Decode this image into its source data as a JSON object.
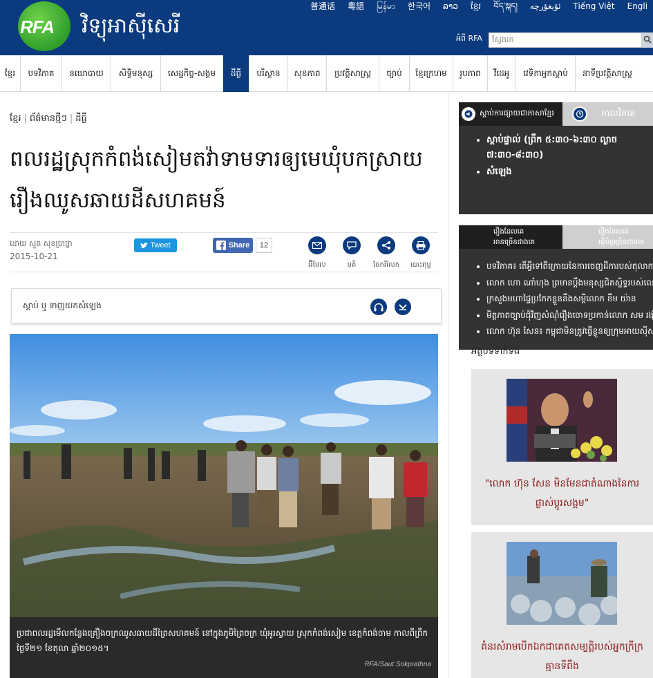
{
  "header": {
    "logo_text": "RFA",
    "site_name": "វិទ្យុអាស៊ីសេរី",
    "languages": [
      "普通话",
      "粵語",
      "မြန်မာ",
      "한국어",
      "ລາວ",
      "ខ្មែរ",
      "བོད་སྐད།",
      "ئۇيغۇرچە",
      "Tiếng Việt",
      "Engli"
    ],
    "about_rfa": "អំពី RFA",
    "search_placeholder": "ស្វែងរក"
  },
  "nav": {
    "items": [
      "ខ្មែរ",
      "បទវិភាគ",
      "នយោបាយ",
      "សិទ្ធិមនុស្ស",
      "សេដ្ឋកិច្ច-សង្គម",
      "ដីធ្លី",
      "បរិស្ថាន",
      "សុខភាព",
      "ប្រវត្តិសាស្ត្រ",
      "ច្បាប់",
      "ខ្មែរក្រហម",
      "រូបភាព",
      "វីដេអូ",
      "វេទិកាអ្នកស្ដាប់",
      "នាទីប្រវត្តិសាស្ត្រ"
    ],
    "active_index": 5
  },
  "breadcrumb": [
    "ខ្មែរ",
    "ព័ត៌មានថ្មីៗ",
    "ដីធ្លី"
  ],
  "article": {
    "title": "ពលរដ្ឋស្រុកកំពង់សៀមតវ៉ាទាមទារឲ្យមេឃុំបកស្រាយរឿងឈូសឆាយដីសហគមន៍",
    "author": "ដោយ សួត សុខប្រាថ្នា",
    "date": "2015-10-21",
    "tweet_label": "Tweet",
    "share_label": "Share",
    "share_count": "12",
    "tools": [
      "អ៊ីមែល",
      "មតិ",
      "ចែករំលែក",
      "បោះពុម្ព"
    ],
    "audio_label": "ស្ដាប់ ឬ ទាញយកសំឡេង",
    "photo_caption": "ប្រជាពលរដ្ឋមើលកន្លែងគ្រឿងចក្រឈូសឆាយដីព្រៃសហគមន៍ នៅក្នុងភូមិព្រៃចក្រ ឃុំអូរស្វាយ ស្រុកកំពង់សៀម ខេត្តកំពង់ចាម កាលពីព្រឹកថ្ងៃទី២១ ខែតុលា ឆ្នាំ២០១៥។",
    "photo_credit": "RFA/Saut Sokprathna"
  },
  "sidebar": {
    "listen_tab": "ស្ដាប់ការផ្សាយជាភាសាខ្មែរ",
    "schedule_tab": "កាលវិភាគ",
    "listen_items": [
      "ស្ដាប់ផ្ទាល់ (ព្រឹក ៥:៣០-៦:៣០ ល្ងាច ៧:៣០-៨:៣០)",
      "សំឡេង"
    ],
    "stories_tab1": [
      "រឿងដែលគេ",
      "អានច្រើនជាងគេ"
    ],
    "stories_tab2": [
      "រឿងដែលគេ",
      "ផ្ញើមិត្តច្រើនជាងគេ"
    ],
    "stories": [
      "បទវិភាគ៖ តើអ្វីទៅពីក្រោយនៃការចេញដីការបស់តុលាការ",
      "លោក ហោ ណាំហុង ព្រមានប្ដឹងមនុស្សជិតស្និទ្ធរបស់លោក",
      "ក្រសួងមហាផ្ទៃប្រកែកខ្លួននឹងសម្ដីលោក ខឹម យ៉ាន",
      "មិត្តភាពច្បាប់ជុំវិញសំណុំរឿងចោទប្រកាន់លោក សម រង្ស៊ី",
      "លោក ហ៊ុន សែន៖ កម្ពុជាមិនត្រូវធ្វើខ្លួនឲ្យក្រុមអាយស៊ីស"
    ],
    "related_heading": "អត្ថបទទាក់ទង",
    "related": [
      {
        "title": "\"លោក ហ៊ុន សែន មិនមែនជាតំណាងនៃការផ្លាស់ប្ដូរសង្គម\""
      },
      {
        "title": "គំនរសំរាមបើកឯកជាគេតសម្បត្តិរបស់អ្នកក្រីក្រគ្មានទីពឹង"
      }
    ]
  },
  "colors": {
    "brand": "#0b3a7e",
    "logo_green": "#2f9e2a",
    "sidebar_dark": "#333333",
    "related_title": "#8b1a1a"
  }
}
